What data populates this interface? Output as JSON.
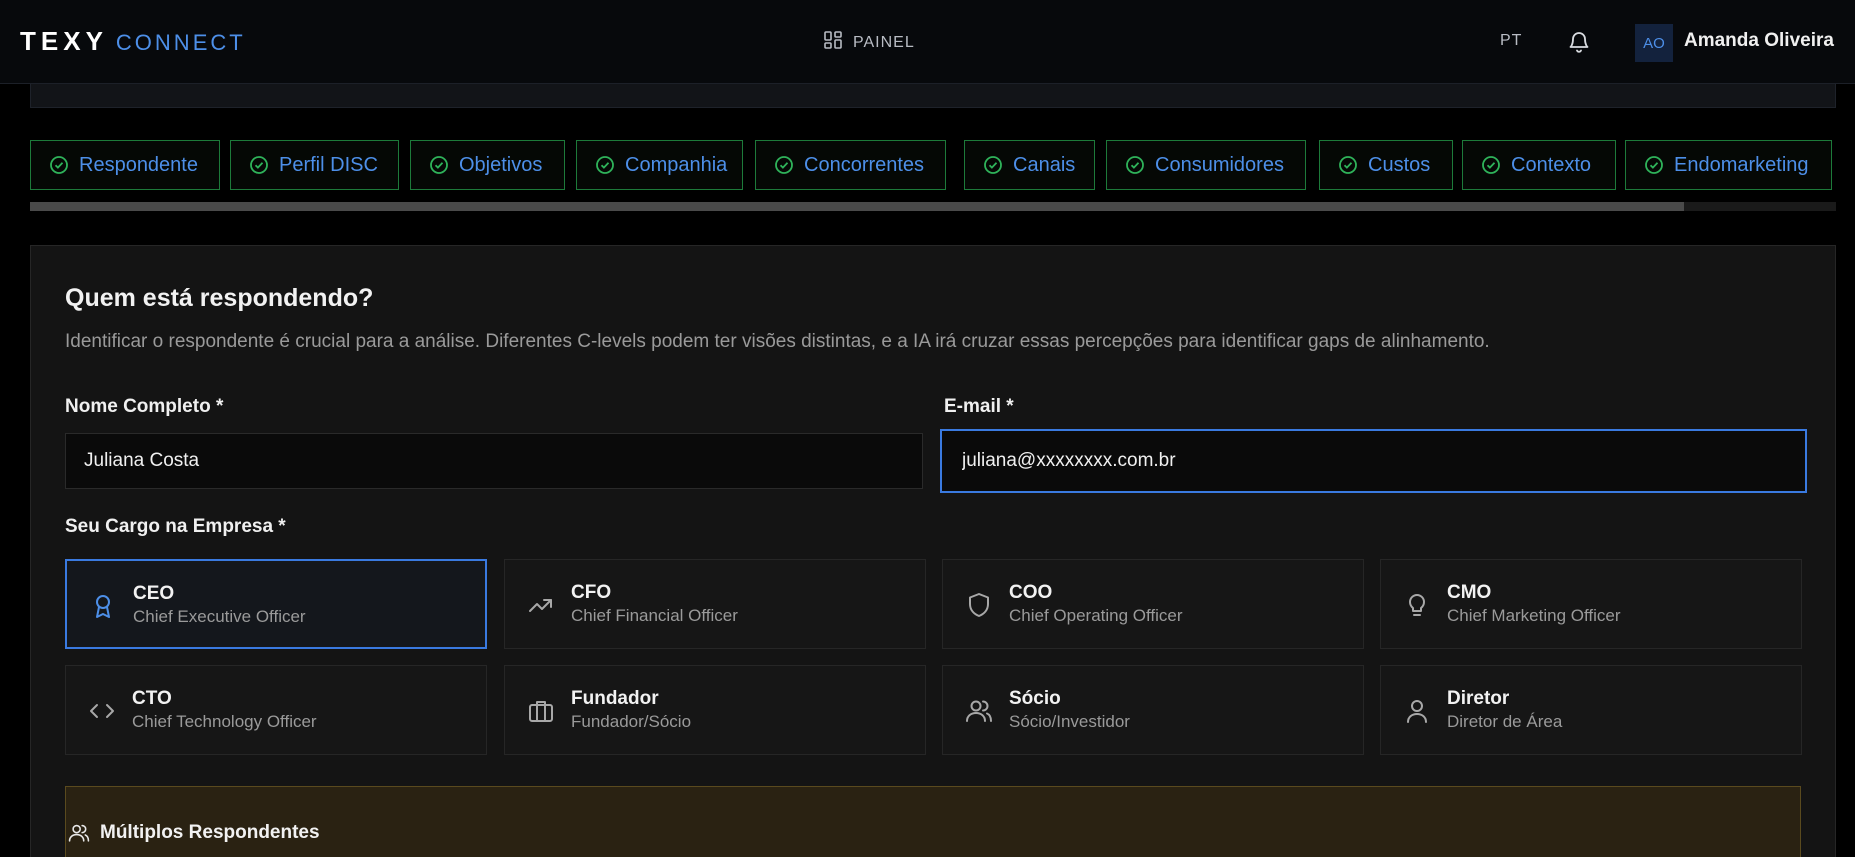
{
  "header": {
    "logo_primary": "TEXY",
    "logo_secondary": "CONNECT",
    "nav_label": "PAINEL",
    "language": "PT",
    "avatar_initials": "AO",
    "user_name": "Amanda Oliveira",
    "icons": {
      "nav": "dashboard-grid-icon",
      "notifications": "bell-icon"
    }
  },
  "steps": [
    {
      "label": "Respondente",
      "status": "complete"
    },
    {
      "label": "Perfil DISC",
      "status": "complete"
    },
    {
      "label": "Objetivos",
      "status": "complete"
    },
    {
      "label": "Companhia",
      "status": "complete"
    },
    {
      "label": "Concorrentes",
      "status": "complete"
    },
    {
      "label": "Canais",
      "status": "complete"
    },
    {
      "label": "Consumidores",
      "status": "complete"
    },
    {
      "label": "Custos",
      "status": "complete"
    },
    {
      "label": "Contexto",
      "status": "complete"
    },
    {
      "label": "Endomarketing",
      "status": "complete"
    }
  ],
  "scroll_progress": 0.916,
  "form": {
    "title": "Quem está respondendo?",
    "description": "Identificar o respondente é crucial para a análise. Diferentes C-levels podem ter visões distintas, e a IA irá cruzar essas percepções para identificar gaps de alinhamento.",
    "name_label": "Nome Completo *",
    "name_value": "Juliana Costa",
    "email_label": "E-mail *",
    "email_value": "juliana@xxxxxxxx.com.br",
    "role_label": "Seu Cargo na Empresa *",
    "roles": [
      {
        "title": "CEO",
        "subtitle": "Chief Executive Officer",
        "icon": "award-ribbon-icon",
        "selected": true
      },
      {
        "title": "CFO",
        "subtitle": "Chief Financial Officer",
        "icon": "trending-up-icon",
        "selected": false
      },
      {
        "title": "COO",
        "subtitle": "Chief Operating Officer",
        "icon": "shield-icon",
        "selected": false
      },
      {
        "title": "CMO",
        "subtitle": "Chief Marketing Officer",
        "icon": "lightbulb-icon",
        "selected": false
      },
      {
        "title": "CTO",
        "subtitle": "Chief Technology Officer",
        "icon": "code-icon",
        "selected": false
      },
      {
        "title": "Fundador",
        "subtitle": "Fundador/Sócio",
        "icon": "briefcase-icon",
        "selected": false
      },
      {
        "title": "Sócio",
        "subtitle": "Sócio/Investidor",
        "icon": "users-icon",
        "selected": false
      },
      {
        "title": "Diretor",
        "subtitle": "Diretor de Área",
        "icon": "user-icon",
        "selected": false
      }
    ],
    "multi_title": "Múltiplos Respondentes"
  },
  "colors": {
    "accent": "#4d8fe8",
    "step_border": "#1d7a3a",
    "check": "#2fb35a",
    "warning_bg": "#2a2212"
  }
}
